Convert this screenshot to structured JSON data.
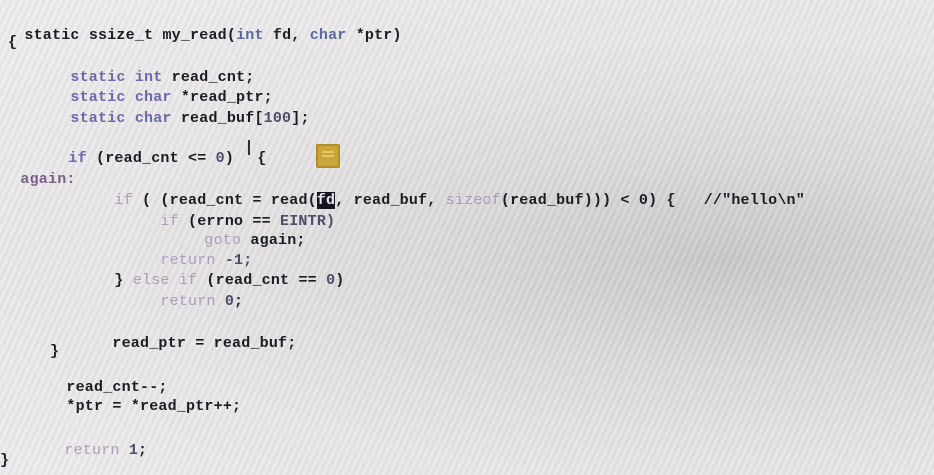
{
  "code": {
    "line1": {
      "kw1": "static",
      "t1": " ssize_t my_read(",
      "kw2": "int",
      "t2": " fd, ",
      "kw3": "char",
      "t3": " *ptr)"
    },
    "line2": {
      "t1": "{"
    },
    "line3": {
      "kw1": "static",
      "t1": " ",
      "kw2": "int",
      "t2": " read_cnt;"
    },
    "line4": {
      "kw1": "static",
      "t1": " ",
      "kw2": "char",
      "t2": " *read_ptr;"
    },
    "line5": {
      "kw1": "static",
      "t1": " ",
      "kw2": "char",
      "t2": " read_buf[",
      "num": "100",
      "t3": "];"
    },
    "line6": {
      "kw1": "if",
      "t1": " (read_cnt <= ",
      "num": "0",
      "t2": ")",
      "t3": " {"
    },
    "line7": {
      "label": "again:"
    },
    "line8": {
      "kw1": "if",
      "t1": " ( (read_cnt = read(",
      "sel": "fd",
      "t2": ", read_buf, ",
      "kw2": "sizeof",
      "t3": "(read_buf))) < 0) {",
      "comment": "//\"hello\\n\""
    },
    "line9": {
      "kw1": "if",
      "t1": " (errno == ",
      "t2": "EINTR)"
    },
    "line10": {
      "kw1": "goto",
      "t1": " again;"
    },
    "line11": {
      "kw1": "return",
      "t1": " -1;"
    },
    "line12": {
      "t0": "} ",
      "kw1": "else if",
      "t1": " (read_cnt == ",
      "num": "0",
      "t2": ")"
    },
    "line13": {
      "kw1": "return",
      "t1": " ",
      "num": "0",
      "t2": ";"
    },
    "line14": {
      "t1": "read_ptr = read_buf;"
    },
    "line15": {
      "t1": "}"
    },
    "line16": {
      "t1": "read_cnt--;"
    },
    "line17": {
      "t1": "*ptr = *read_ptr++;"
    },
    "line18": {
      "kw1": "return",
      "t1": " ",
      "num": "1",
      "t2": ";"
    },
    "line19": {
      "t1": "}"
    }
  },
  "cursor": "I",
  "colors": {
    "keyword": "#6b6aa8",
    "text": "#1c1c24",
    "selection": "#151520",
    "widget": "#c9a53b"
  },
  "icons": {
    "widget": "drag-handle-icon",
    "caret": "text-cursor-icon"
  }
}
